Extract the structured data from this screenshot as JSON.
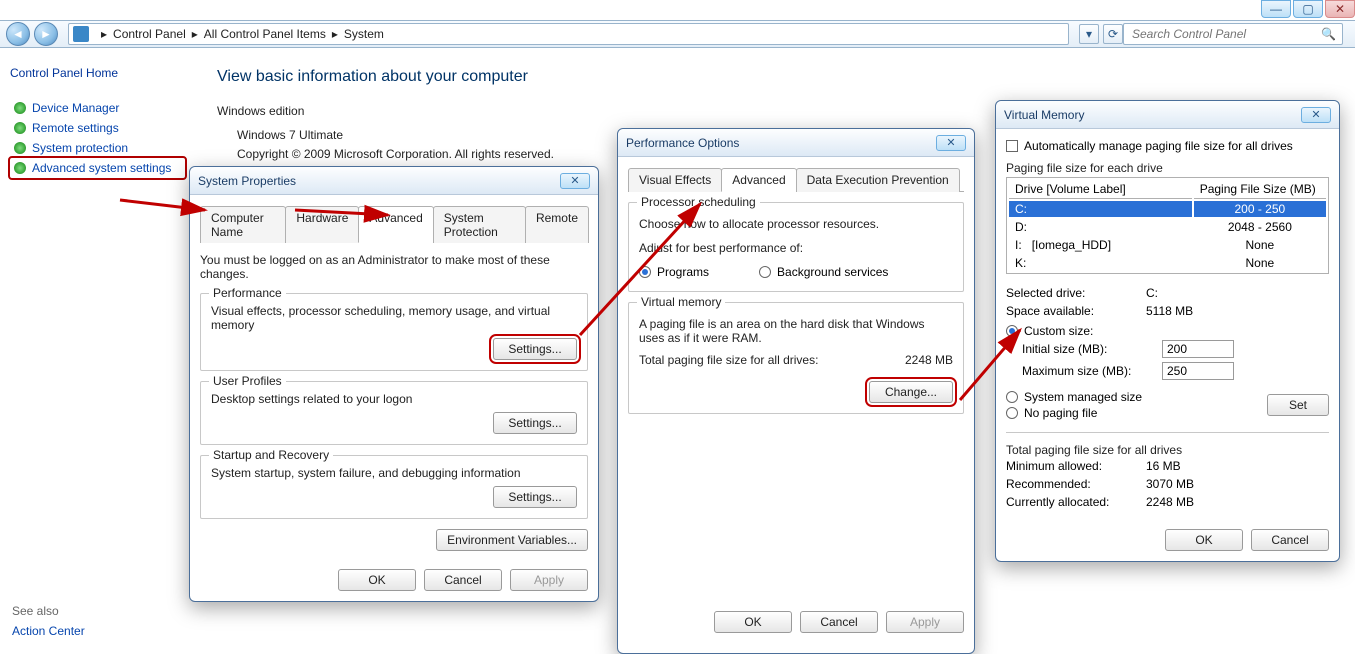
{
  "chrome": {
    "min": "—",
    "max": "▢",
    "close": "✕"
  },
  "nav": {
    "back_glyph": "◄",
    "fwd_glyph": "►",
    "crumbs": [
      "Control Panel",
      "All Control Panel Items",
      "System"
    ],
    "refresh_glyph": "⟳",
    "dropdown_glyph": "▾",
    "search_placeholder": "Search Control Panel",
    "search_glyph": "🔍"
  },
  "left": {
    "home": "Control Panel Home",
    "items": [
      {
        "label": "Device Manager"
      },
      {
        "label": "Remote settings"
      },
      {
        "label": "System protection"
      },
      {
        "label": "Advanced system settings"
      }
    ],
    "seealso_hdr": "See also",
    "seealso_link": "Action Center"
  },
  "main": {
    "title": "View basic information about your computer",
    "we_hdr": "Windows edition",
    "we_line1": "Windows 7 Ultimate",
    "we_line2": "Copyright © 2009 Microsoft Corporation.  All rights reserved."
  },
  "sysprops": {
    "title": "System Properties",
    "close_glyph": "✕",
    "tabs": [
      "Computer Name",
      "Hardware",
      "Advanced",
      "System Protection",
      "Remote"
    ],
    "active_tab_index": 2,
    "admin_note": "You must be logged on as an Administrator to make most of these changes.",
    "perf": {
      "legend": "Performance",
      "desc": "Visual effects, processor scheduling, memory usage, and virtual memory",
      "btn": "Settings..."
    },
    "user": {
      "legend": "User Profiles",
      "desc": "Desktop settings related to your logon",
      "btn": "Settings..."
    },
    "startup": {
      "legend": "Startup and Recovery",
      "desc": "System startup, system failure, and debugging information",
      "btn": "Settings..."
    },
    "envbtn": "Environment Variables...",
    "ok": "OK",
    "cancel": "Cancel",
    "apply": "Apply"
  },
  "perfopts": {
    "title": "Performance Options",
    "close_glyph": "✕",
    "tabs": [
      "Visual Effects",
      "Advanced",
      "Data Execution Prevention"
    ],
    "active_tab_index": 1,
    "ps": {
      "legend": "Processor scheduling",
      "desc": "Choose how to allocate processor resources.",
      "adjust": "Adjust for best performance of:",
      "opt1": "Programs",
      "opt2": "Background services"
    },
    "vm": {
      "legend": "Virtual memory",
      "desc": "A paging file is an area on the hard disk that Windows uses as if it were RAM.",
      "total_lbl": "Total paging file size for all drives:",
      "total_val": "2248 MB",
      "change": "Change..."
    },
    "ok": "OK",
    "cancel": "Cancel",
    "apply": "Apply"
  },
  "vmem": {
    "title": "Virtual Memory",
    "close_glyph": "✕",
    "auto_label": "Automatically manage paging file size for all drives",
    "pf_hdr": "Paging file size for each drive",
    "col_drive": "Drive  [Volume Label]",
    "col_pf": "Paging File Size (MB)",
    "drives": [
      {
        "drv": "C:",
        "vol": "",
        "pf": "200 - 250",
        "sel": true
      },
      {
        "drv": "D:",
        "vol": "",
        "pf": "2048 - 2560",
        "sel": false
      },
      {
        "drv": "I:",
        "vol": "[Iomega_HDD]",
        "pf": "None",
        "sel": false
      },
      {
        "drv": "K:",
        "vol": "",
        "pf": "None",
        "sel": false
      }
    ],
    "seldrv_lbl": "Selected drive:",
    "seldrv_val": "C:",
    "space_lbl": "Space available:",
    "space_val": "5118 MB",
    "custom_label": "Custom size:",
    "init_lbl": "Initial size (MB):",
    "init_val": "200",
    "max_lbl": "Maximum size (MB):",
    "max_val": "250",
    "sysman_label": "System managed size",
    "nopf_label": "No paging file",
    "set_btn": "Set",
    "tot_hdr": "Total paging file size for all drives",
    "min_lbl": "Minimum allowed:",
    "min_val": "16 MB",
    "rec_lbl": "Recommended:",
    "rec_val": "3070 MB",
    "cur_lbl": "Currently allocated:",
    "cur_val": "2248 MB",
    "ok": "OK",
    "cancel": "Cancel"
  }
}
